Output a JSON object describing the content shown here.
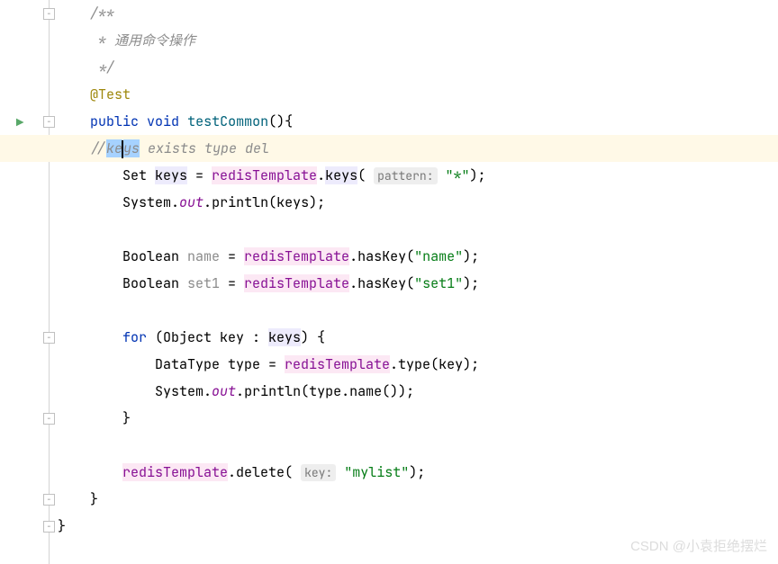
{
  "code": {
    "comment_start": "/**",
    "comment_body": " * 通用命令操作",
    "comment_end": " */",
    "annotation": "@Test",
    "kw_public": "public",
    "kw_void": "void",
    "method_name": "testCommon",
    "paren_open": "(){",
    "inline_comment_prefix": "//",
    "inline_comment_sel1": "ke",
    "inline_comment_sel2": "ys",
    "inline_comment_rest": " exists type del",
    "type_set": "Set ",
    "var_keys": "keys",
    "eq": " = ",
    "redis_template": "redisTemplate",
    "dot": ".",
    "method_keys": "keys",
    "param_pattern": "pattern:",
    "str_star": "\"*\"",
    "semicolon": ");",
    "system": "System",
    "out": "out",
    "println": "println",
    "args_keys": "(keys);",
    "type_boolean": "Boolean ",
    "var_name": "name",
    "method_haskey": "hasKey",
    "str_name": "\"name\"",
    "var_set1": "set1",
    "str_set1": "\"set1\"",
    "kw_for": "for",
    "for_args": " (Object key : ",
    "brace_open": ") {",
    "type_datatype": "DataType type = ",
    "method_type": "type",
    "args_key": "(key);",
    "args_typename": "(type.",
    "method_name2": "name",
    "args_close": "());",
    "brace_close": "}",
    "method_delete": "delete",
    "param_key": "key:",
    "str_mylist": "\"mylist\""
  },
  "watermark": "CSDN @小袁拒绝摆烂"
}
